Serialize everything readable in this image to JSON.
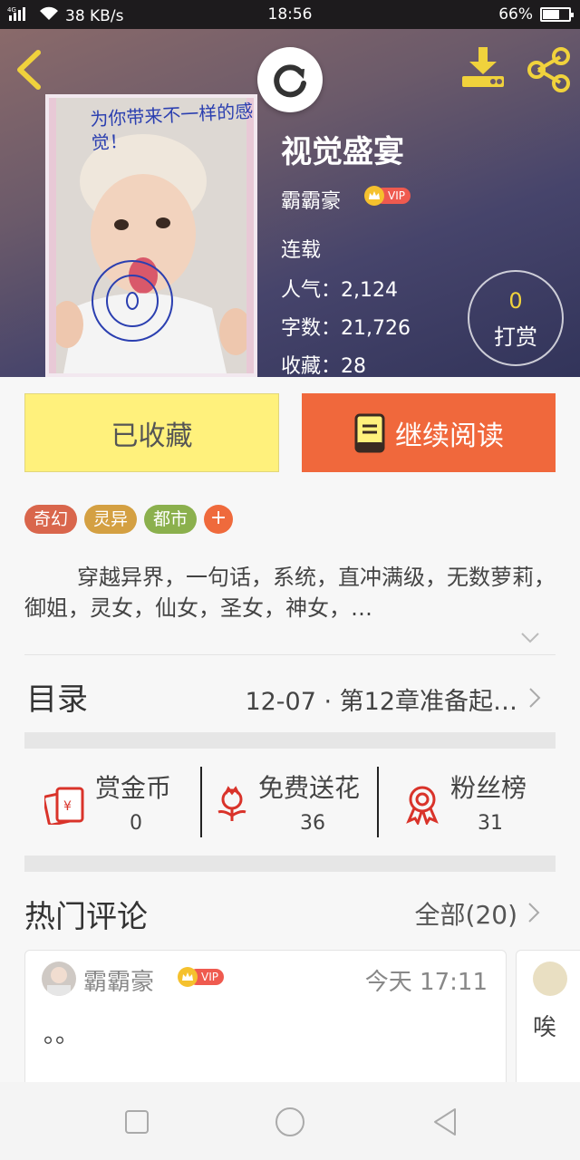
{
  "status_bar": {
    "network_label": "4G",
    "speed": "38 KB/s",
    "time": "18:56",
    "battery_percent": "66%",
    "battery_level": 0.66
  },
  "header": {
    "cover_caption": "为你带来不一样的感觉！",
    "title": "视觉盛宴",
    "author": "霸霸豪",
    "vip_label": "VIP",
    "status": "连载",
    "popularity": "人气：2,124",
    "word_count": "字数：21,726",
    "favorites": "收藏：28",
    "reward_count": "0",
    "reward_label": "打赏"
  },
  "actions": {
    "favorited_label": "已收藏",
    "continue_label": "继续阅读"
  },
  "tags": [
    {
      "label": "奇幻",
      "color": "#d9664c"
    },
    {
      "label": "灵异",
      "color": "#d4a042"
    },
    {
      "label": "都市",
      "color": "#8bb04d"
    }
  ],
  "tag_add_label": "+",
  "description": "穿越异界，一句话，系统，直冲满级，无数萝莉，御姐，灵女，仙女，圣女，神女，…",
  "toc": {
    "label": "目录",
    "latest": "12-07 · 第12章准备起…"
  },
  "stats": [
    {
      "name": "赏金币",
      "value": "0",
      "icon": "red-envelope-icon"
    },
    {
      "name": "免费送花",
      "value": "36",
      "icon": "flower-icon"
    },
    {
      "name": "粉丝榜",
      "value": "31",
      "icon": "medal-icon"
    }
  ],
  "comments_section": {
    "title": "热门评论",
    "all_label": "全部(20)"
  },
  "comments": [
    {
      "user": "霸霸豪",
      "vip": "VIP",
      "time": "今天 17:11",
      "text": "。。"
    },
    {
      "text": "唉"
    }
  ],
  "colors": {
    "accent_orange": "#f0683c",
    "favorite_yellow": "#fff17c",
    "vip_red": "#ef5a4f",
    "icon_red": "#d9332a"
  }
}
